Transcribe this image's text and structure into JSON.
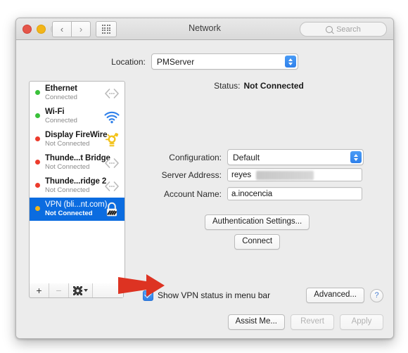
{
  "window": {
    "title": "Network",
    "traffic_lights": [
      "close",
      "minimize",
      "zoom-disabled"
    ],
    "nav_back": "‹",
    "nav_forward": "›",
    "grid_button": "show-all-icon",
    "search_placeholder": "Search"
  },
  "location": {
    "label": "Location:",
    "value": "PMServer"
  },
  "services": [
    {
      "name": "Ethernet",
      "status": "Connected",
      "dot": "green",
      "icon": "ethernet-icon",
      "selected": false
    },
    {
      "name": "Wi-Fi",
      "status": "Connected",
      "dot": "green",
      "icon": "wifi-icon",
      "selected": false
    },
    {
      "name": "Display FireWire",
      "status": "Not Connected",
      "dot": "red",
      "icon": "firewire-icon",
      "selected": false
    },
    {
      "name": "Thunde...t Bridge",
      "status": "Not Connected",
      "dot": "red",
      "icon": "ethernet-icon",
      "selected": false
    },
    {
      "name": "Thunde...ridge 2",
      "status": "Not Connected",
      "dot": "red",
      "icon": "ethernet-icon",
      "selected": false
    },
    {
      "name": "VPN (bli...nt.com)",
      "status": "Not Connected",
      "dot": "amber",
      "icon": "vpn-lock-icon",
      "selected": true
    }
  ],
  "list_toolbar": {
    "add": "+",
    "remove": "−",
    "actions": "gear-icon"
  },
  "details": {
    "status_label": "Status:",
    "status_value": "Not Connected",
    "configuration_label": "Configuration:",
    "configuration_value": "Default",
    "server_address_label": "Server Address:",
    "server_address_value": "reyes",
    "server_address_redacted": true,
    "account_name_label": "Account Name:",
    "account_name_value": "a.inocencia",
    "auth_button": "Authentication Settings...",
    "connect_button": "Connect"
  },
  "options": {
    "show_vpn_status_label": "Show VPN status in menu bar",
    "show_vpn_status_checked": true,
    "advanced_button": "Advanced...",
    "help_button": "?"
  },
  "footer": {
    "assist_me": "Assist Me...",
    "revert": "Revert",
    "apply": "Apply",
    "revert_disabled": true,
    "apply_disabled": true
  },
  "annotation": {
    "type": "red-arrow",
    "points_at": "show-vpn-status-checkbox",
    "color": "#dd3322"
  }
}
